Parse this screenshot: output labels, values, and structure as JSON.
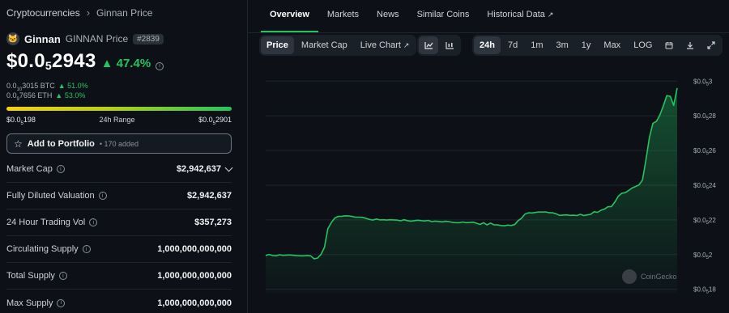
{
  "breadcrumb": {
    "root": "Cryptocurrencies",
    "current": "Ginnan Price"
  },
  "coin": {
    "name": "Ginnan",
    "symbol_label": "GINNAN Price",
    "rank": "#2839"
  },
  "price": {
    "lead": "$0.0",
    "sub": "5",
    "tail": "2943",
    "change": "47.4%"
  },
  "btc": {
    "lead": "0.0",
    "sub": "10",
    "tail": "3015 BTC",
    "change": "51.0%"
  },
  "eth": {
    "lead": "0.0",
    "sub": "9",
    "tail": "7656 ETH",
    "change": "53.0%"
  },
  "range": {
    "low_lead": "$0.0",
    "low_sub": "5",
    "low_tail": "198",
    "label": "24h Range",
    "high_lead": "$0.0",
    "high_sub": "5",
    "high_tail": "2901",
    "position": 0.97
  },
  "portfolio": {
    "label": "Add to Portfolio",
    "added": "• 170 added"
  },
  "stats": [
    {
      "label": "Market Cap",
      "value": "$2,942,637"
    },
    {
      "label": "Fully Diluted Valuation",
      "value": "$2,942,637"
    },
    {
      "label": "24 Hour Trading Vol",
      "value": "$357,273"
    },
    {
      "label": "Circulating Supply",
      "value": "1,000,000,000,000"
    },
    {
      "label": "Total Supply",
      "value": "1,000,000,000,000"
    },
    {
      "label": "Max Supply",
      "value": "1,000,000,000,000"
    }
  ],
  "tabs": [
    "Overview",
    "Markets",
    "News",
    "Similar Coins",
    "Historical Data"
  ],
  "chart_controls": {
    "view": [
      "Price",
      "Market Cap",
      "Live Chart"
    ],
    "ranges": [
      "24h",
      "7d",
      "1m",
      "3m",
      "1y",
      "Max",
      "LOG"
    ],
    "active_view": "Price",
    "active_range": "24h"
  },
  "watermark": "CoinGecko",
  "icons": {
    "external": "external-link-icon",
    "line": "line-chart-icon",
    "candle": "candlestick-icon",
    "calendar": "calendar-icon",
    "download": "download-icon",
    "expand": "expand-icon",
    "star": "star-icon",
    "info": "info-icon"
  },
  "colors": {
    "accent": "#22c55e",
    "background": "#0d1117"
  },
  "chart_data": {
    "type": "area",
    "title": "",
    "xlabel": "",
    "ylabel": "",
    "y_tick_labels": [
      {
        "lead": "$0.0",
        "sub": "5",
        "tail": "3"
      },
      {
        "lead": "$0.0",
        "sub": "5",
        "tail": "28"
      },
      {
        "lead": "$0.0",
        "sub": "5",
        "tail": "26"
      },
      {
        "lead": "$0.0",
        "sub": "5",
        "tail": "24"
      },
      {
        "lead": "$0.0",
        "sub": "5",
        "tail": "22"
      },
      {
        "lead": "$0.0",
        "sub": "5",
        "tail": "2"
      },
      {
        "lead": "$0.0",
        "sub": "5",
        "tail": "18"
      }
    ],
    "y_ticks": [
      0.3,
      0.28,
      0.26,
      0.24,
      0.22,
      0.2,
      0.18
    ],
    "ylim": [
      0.178,
      0.302
    ],
    "y_unit_note": "values are price × 1e5 (i.e. $0.0000X)",
    "x": [
      0,
      1,
      2,
      3,
      4,
      5,
      6,
      7,
      8,
      9,
      10,
      11,
      12,
      13,
      14,
      15,
      16,
      17,
      18,
      19,
      20,
      21,
      22,
      23,
      24,
      25,
      26,
      27,
      28,
      29,
      30,
      31,
      32,
      33,
      34,
      35,
      36,
      37,
      38,
      39,
      40,
      41,
      42,
      43,
      44,
      45,
      46,
      47,
      48,
      49,
      50,
      51,
      52,
      53,
      54,
      55,
      56,
      57,
      58,
      59,
      60,
      61,
      62,
      63,
      64,
      65,
      66,
      67,
      68,
      69,
      70,
      71,
      72,
      73,
      74,
      75,
      76,
      77,
      78,
      79,
      80,
      81,
      82,
      83,
      84,
      85,
      86,
      87,
      88,
      89,
      90,
      91,
      92,
      93,
      94,
      95,
      96,
      97,
      98,
      99,
      100,
      101,
      102,
      103,
      104,
      105,
      106,
      107,
      108,
      109,
      110,
      111,
      112,
      113,
      114,
      115,
      116,
      117,
      118,
      119
    ],
    "values": [
      0.1995,
      0.2001,
      0.1995,
      0.1993,
      0.1999,
      0.1996,
      0.1997,
      0.1998,
      0.1996,
      0.1994,
      0.1993,
      0.1993,
      0.1995,
      0.1993,
      0.1976,
      0.198,
      0.2001,
      0.2043,
      0.215,
      0.2185,
      0.2211,
      0.222,
      0.2221,
      0.2224,
      0.2223,
      0.222,
      0.2216,
      0.2216,
      0.2215,
      0.2209,
      0.2203,
      0.2199,
      0.2205,
      0.22,
      0.2201,
      0.2199,
      0.2201,
      0.22,
      0.2199,
      0.2195,
      0.2201,
      0.2196,
      0.2193,
      0.2196,
      0.2198,
      0.2196,
      0.2194,
      0.2197,
      0.219,
      0.2193,
      0.2191,
      0.2189,
      0.2192,
      0.219,
      0.2186,
      0.2184,
      0.2184,
      0.2188,
      0.2184,
      0.2185,
      0.2187,
      0.2181,
      0.2174,
      0.2184,
      0.2171,
      0.2182,
      0.2172,
      0.2171,
      0.2168,
      0.2166,
      0.217,
      0.2168,
      0.2173,
      0.2196,
      0.221,
      0.2234,
      0.2241,
      0.224,
      0.2243,
      0.2246,
      0.2245,
      0.2246,
      0.2241,
      0.2241,
      0.2235,
      0.2226,
      0.2228,
      0.2229,
      0.2226,
      0.2227,
      0.2225,
      0.2232,
      0.2225,
      0.2229,
      0.2232,
      0.2247,
      0.2244,
      0.2256,
      0.2263,
      0.2276,
      0.2277,
      0.2304,
      0.2337,
      0.2354,
      0.2357,
      0.237,
      0.2384,
      0.2393,
      0.2402,
      0.2431,
      0.255,
      0.2676,
      0.2757,
      0.2768,
      0.2805,
      0.2857,
      0.2916,
      0.2913,
      0.286,
      0.296
    ]
  }
}
